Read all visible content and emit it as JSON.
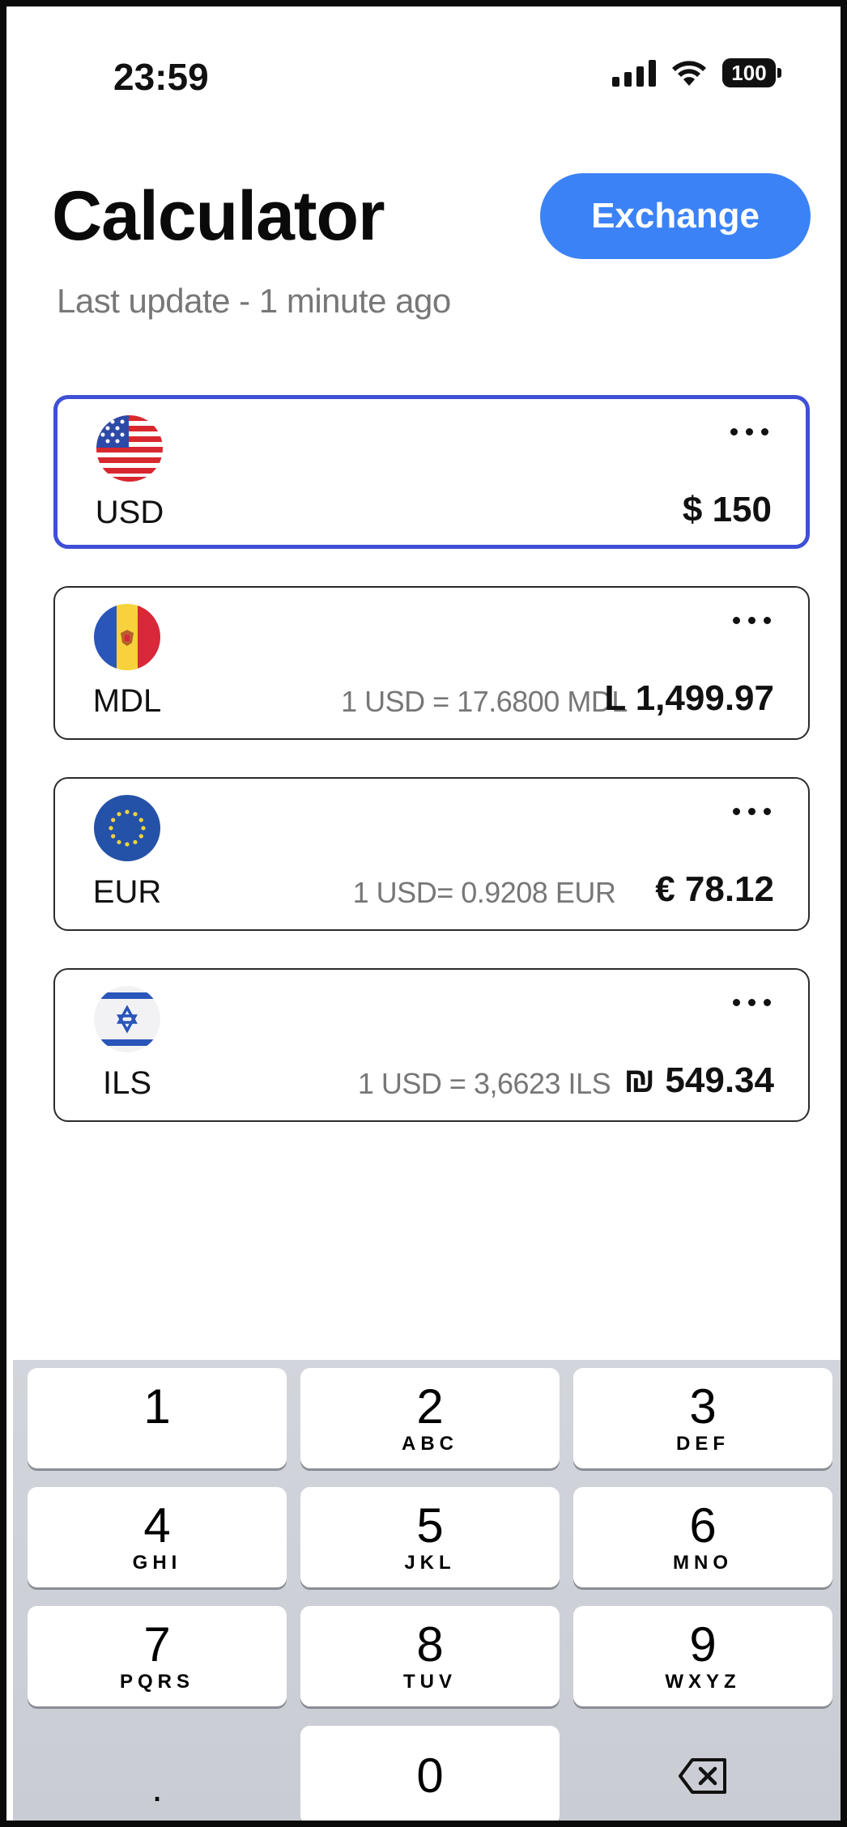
{
  "status_bar": {
    "time": "23:59",
    "battery": "100",
    "icons": [
      "signal-icon",
      "wifi-icon",
      "battery-icon"
    ]
  },
  "header": {
    "title": "Calculator",
    "exchange_label": "Exchange",
    "last_update": "Last update - 1 minute ago"
  },
  "currencies": [
    {
      "code": "USD",
      "rate": "",
      "amount": "$ 150",
      "flag": "us-flag-icon",
      "selected": true
    },
    {
      "code": "MDL",
      "rate": "1 USD = 17.6800 MDL",
      "amount": "L 1,499.97",
      "flag": "moldova-flag-icon",
      "selected": false
    },
    {
      "code": "EUR",
      "rate": "1 USD= 0.9208 EUR",
      "amount": "€ 78.12",
      "flag": "eu-flag-icon",
      "selected": false
    },
    {
      "code": "ILS",
      "rate": "1 USD = 3,6623 ILS",
      "amount": "₪ 549.34",
      "flag": "israel-flag-icon",
      "selected": false
    }
  ],
  "keypad": {
    "keys": [
      {
        "digit": "1",
        "letters": ""
      },
      {
        "digit": "2",
        "letters": "ABC"
      },
      {
        "digit": "3",
        "letters": "DEF"
      },
      {
        "digit": "4",
        "letters": "GHI"
      },
      {
        "digit": "5",
        "letters": "JKL"
      },
      {
        "digit": "6",
        "letters": "MNO"
      },
      {
        "digit": "7",
        "letters": "PQRS"
      },
      {
        "digit": "8",
        "letters": "TUV"
      },
      {
        "digit": "9",
        "letters": "WXYZ"
      }
    ],
    "dot": ".",
    "zero": "0",
    "backspace_icon": "backspace-icon"
  },
  "colors": {
    "accent": "#3b82f6",
    "selected_border": "#3f4fd6",
    "muted_text": "#777777",
    "keypad_bg": "#d2d5db"
  }
}
